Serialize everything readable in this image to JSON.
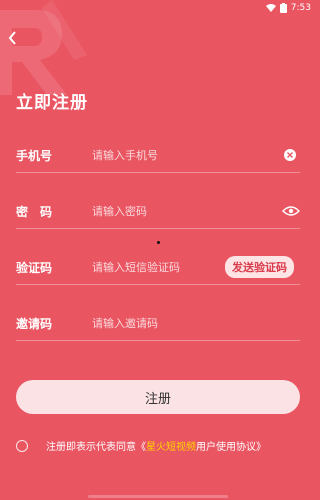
{
  "status_bar": {
    "time": "7:53",
    "wifi_icon": "wifi-icon"
  },
  "page": {
    "title": "立即注册"
  },
  "form": {
    "phone": {
      "label": "手机号",
      "placeholder": "请输入手机号"
    },
    "password": {
      "label": "密　码",
      "placeholder": "请输入密码"
    },
    "code": {
      "label": "验证码",
      "placeholder": "请输入短信验证码",
      "send_label": "发送验证码"
    },
    "invite": {
      "label": "邀请码",
      "placeholder": "请输入邀请码"
    }
  },
  "register_button": "注册",
  "agreement": {
    "prefix": "注册即表示代表同意《",
    "brand": "星火短视频",
    "suffix": "用户使用协议》"
  },
  "colors": {
    "background": "#ea5562",
    "button": "#fbe2e4",
    "accent_text": "#ffd400"
  }
}
